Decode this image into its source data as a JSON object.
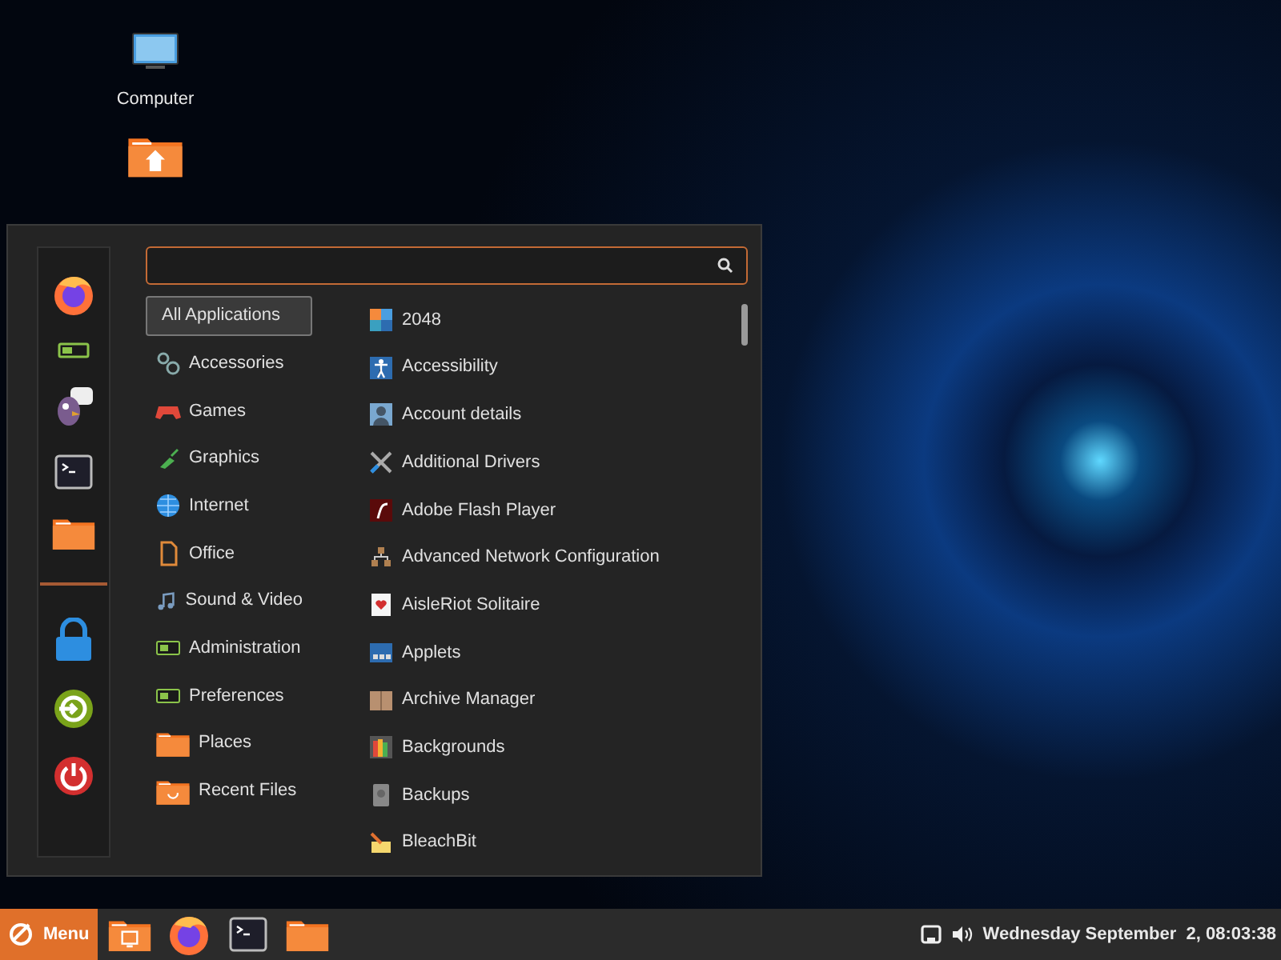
{
  "desktop_icons": [
    {
      "kind": "computer",
      "label": "Computer"
    },
    {
      "kind": "home"
    }
  ],
  "menu": {
    "favorites": [
      {
        "kind": "firefox"
      },
      {
        "kind": "settings"
      },
      {
        "kind": "chat"
      },
      {
        "kind": "terminal"
      },
      {
        "kind": "folder"
      },
      {
        "kind": "separator"
      },
      {
        "kind": "lock"
      },
      {
        "kind": "logout"
      },
      {
        "kind": "power"
      }
    ],
    "categories": [
      {
        "label": "All Applications",
        "kind": "none",
        "selected": true
      },
      {
        "label": "Accessories",
        "kind": "gears",
        "selected": false
      },
      {
        "label": "Games",
        "kind": "gamepad",
        "selected": false
      },
      {
        "label": "Graphics",
        "kind": "brush",
        "selected": false
      },
      {
        "label": "Internet",
        "kind": "globe",
        "selected": false
      },
      {
        "label": "Office",
        "kind": "document",
        "selected": false
      },
      {
        "label": "Sound & Video",
        "kind": "music",
        "selected": false
      },
      {
        "label": "Administration",
        "kind": "settings",
        "selected": false
      },
      {
        "label": "Preferences",
        "kind": "settings",
        "selected": false
      },
      {
        "label": "Places",
        "kind": "folder",
        "selected": false
      },
      {
        "label": "Recent Files",
        "kind": "recent",
        "selected": false
      }
    ],
    "applications": [
      {
        "label": "2048",
        "kind": "tiles"
      },
      {
        "label": "Accessibility",
        "kind": "person"
      },
      {
        "label": "Account details",
        "kind": "user"
      },
      {
        "label": "Additional Drivers",
        "kind": "tools"
      },
      {
        "label": "Adobe Flash Player",
        "kind": "flash"
      },
      {
        "label": "Advanced Network Configuration",
        "kind": "network"
      },
      {
        "label": "AisleRiot Solitaire",
        "kind": "card"
      },
      {
        "label": "Applets",
        "kind": "panel"
      },
      {
        "label": "Archive Manager",
        "kind": "box"
      },
      {
        "label": "Backgrounds",
        "kind": "books"
      },
      {
        "label": "Backups",
        "kind": "drive"
      },
      {
        "label": "BleachBit",
        "kind": "broom"
      }
    ]
  },
  "taskbar": {
    "menu_button": "Menu",
    "launchers": [
      {
        "kind": "folder-screen"
      },
      {
        "kind": "firefox"
      },
      {
        "kind": "terminal"
      },
      {
        "kind": "folder"
      }
    ],
    "tray": [
      {
        "kind": "network"
      },
      {
        "kind": "volume"
      }
    ],
    "clock": "Wednesday September  2, 08:03:38"
  }
}
